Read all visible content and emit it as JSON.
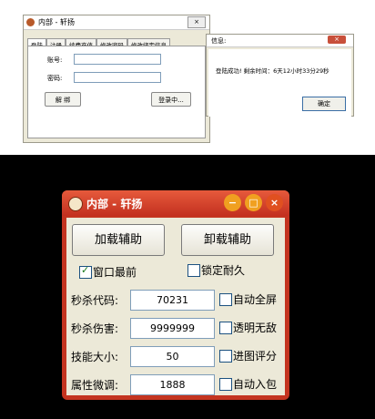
{
  "login_window": {
    "title": "内部 - 轩扬",
    "close_glyph": "×",
    "tabs": [
      "登陆",
      "注册",
      "续费充值",
      "修改密码",
      "修改绑定信息"
    ],
    "account_label": "账号:",
    "password_label": "密码:",
    "unbind_button": "解 绑",
    "login_button": "登录中..."
  },
  "info_dialog": {
    "title": "信息:",
    "close_glyph": "×",
    "message": "登陆成功! 剩余时间：6天12小时33分29秒",
    "ok_button": "确定"
  },
  "main_window": {
    "title": "内部 - 轩扬",
    "min_glyph": "−",
    "max_glyph": "□",
    "close_glyph": "×",
    "load_button": "加载辅助",
    "unload_button": "卸载辅助",
    "topmost_label": "窗口最前",
    "topmost_checked": true,
    "lock_durability_label": "锁定耐久",
    "lock_durability_checked": false,
    "fields": [
      {
        "label": "秒杀代码:",
        "value": "70231",
        "option": "自动全屏"
      },
      {
        "label": "秒杀伤害:",
        "value": "9999999",
        "option": "透明无敌"
      },
      {
        "label": "技能大小:",
        "value": "50",
        "option": "进图评分"
      },
      {
        "label": "属性微调:",
        "value": "1888",
        "option": "自动入包"
      }
    ]
  },
  "colors": {
    "title_red": "#c43420",
    "window_face": "#ece9d8",
    "min_btn": "#f0a020",
    "close_btn": "#e05020"
  }
}
